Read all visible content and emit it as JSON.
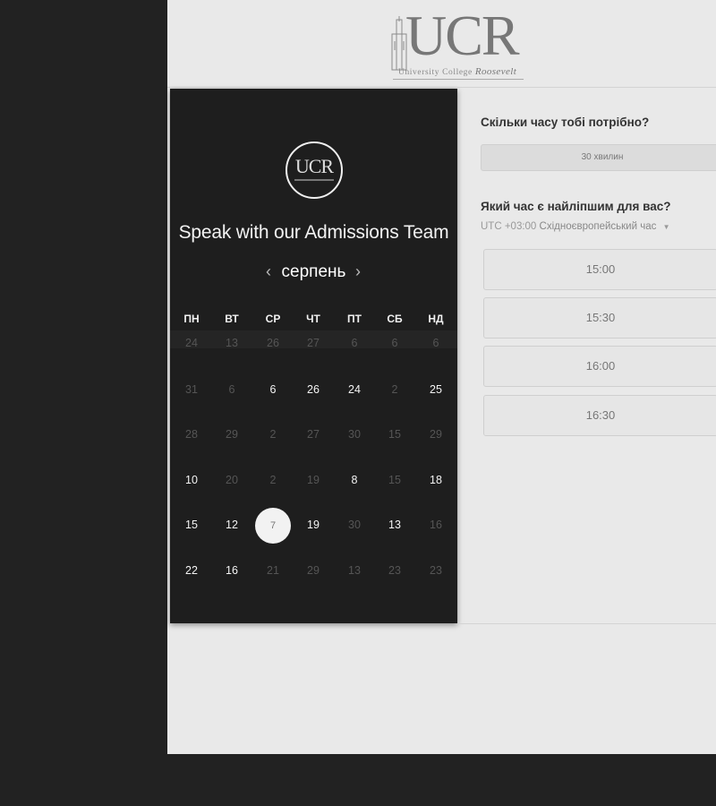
{
  "logo": {
    "letters": "UCR",
    "subtitle": "University College",
    "subtitle_italic": "Roosevelt"
  },
  "calendar": {
    "badge_text": "UCR",
    "title": "Speak with our Admissions Team",
    "month": "серпень",
    "prev_icon": "‹",
    "next_icon": "›",
    "weekdays": [
      "ПН",
      "ВТ",
      "СР",
      "ЧТ",
      "ПТ",
      "СБ",
      "НД"
    ],
    "rows": [
      [
        {
          "d": "24",
          "a": false
        },
        {
          "d": "13",
          "a": false
        },
        {
          "d": "26",
          "a": false
        },
        {
          "d": "27",
          "a": false
        },
        {
          "d": "6",
          "a": false
        },
        {
          "d": "6",
          "a": false
        },
        {
          "d": "6",
          "a": false
        }
      ],
      [
        {
          "d": "31",
          "a": false
        },
        {
          "d": "6",
          "a": false
        },
        {
          "d": "6",
          "a": true
        },
        {
          "d": "26",
          "a": true
        },
        {
          "d": "24",
          "a": true
        },
        {
          "d": "2",
          "a": false
        },
        {
          "d": "25",
          "a": true
        }
      ],
      [
        {
          "d": "28",
          "a": false
        },
        {
          "d": "29",
          "a": false
        },
        {
          "d": "2",
          "a": false
        },
        {
          "d": "27",
          "a": false
        },
        {
          "d": "30",
          "a": false
        },
        {
          "d": "15",
          "a": false
        },
        {
          "d": "29",
          "a": false
        }
      ],
      [
        {
          "d": "10",
          "a": true
        },
        {
          "d": "20",
          "a": false
        },
        {
          "d": "2",
          "a": false
        },
        {
          "d": "19",
          "a": false
        },
        {
          "d": "8",
          "a": true
        },
        {
          "d": "15",
          "a": false
        },
        {
          "d": "18",
          "a": true
        }
      ],
      [
        {
          "d": "15",
          "a": true
        },
        {
          "d": "12",
          "a": true
        },
        {
          "d": "7",
          "a": true,
          "selected": true
        },
        {
          "d": "19",
          "a": true
        },
        {
          "d": "30",
          "a": false
        },
        {
          "d": "13",
          "a": true
        },
        {
          "d": "16",
          "a": false
        }
      ],
      [
        {
          "d": "22",
          "a": true
        },
        {
          "d": "16",
          "a": true
        },
        {
          "d": "21",
          "a": false
        },
        {
          "d": "29",
          "a": false
        },
        {
          "d": "13",
          "a": false
        },
        {
          "d": "23",
          "a": false
        },
        {
          "d": "23",
          "a": false
        }
      ]
    ]
  },
  "booking": {
    "duration_question": "Скільки часу тобі потрібно?",
    "duration_value": "30 хвилин",
    "time_question": "Який час є найліпшим для вас?",
    "timezone_offset": "UTC +03:00",
    "timezone_name": "Східноєвропейський час",
    "timezone_caret": "▼",
    "slots": [
      "15:00",
      "15:30",
      "16:00",
      "16:30"
    ]
  },
  "colors": {
    "calendar_bg": "#1e1e1e",
    "page_bg": "#e9e9e9",
    "outer_bg": "#222222"
  }
}
